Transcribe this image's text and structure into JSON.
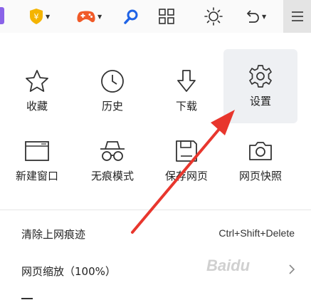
{
  "toolbar": {
    "icons": [
      "extension-stub-icon",
      "yen-shield-icon",
      "gamepad-icon",
      "search-icon",
      "grid-icon",
      "brightness-icon",
      "undo-icon",
      "hamburger-menu-icon"
    ]
  },
  "grid": {
    "row1": [
      {
        "label": "收藏",
        "icon": "star-icon"
      },
      {
        "label": "历史",
        "icon": "clock-icon"
      },
      {
        "label": "下载",
        "icon": "download-arrow-icon"
      },
      {
        "label": "设置",
        "icon": "gear-icon"
      }
    ],
    "row2": [
      {
        "label": "新建窗口",
        "icon": "new-window-icon"
      },
      {
        "label": "无痕模式",
        "icon": "incognito-icon"
      },
      {
        "label": "保存网页",
        "icon": "save-page-icon"
      },
      {
        "label": "网页快照",
        "icon": "camera-icon"
      }
    ]
  },
  "menu": {
    "clear": {
      "label": "清除上网痕迹",
      "shortcut": "Ctrl+Shift+Delete"
    },
    "zoom": {
      "label": "网页缩放（100%）"
    }
  },
  "watermark": {
    "text": "Baidu"
  },
  "colors": {
    "accent_active_bg": "#eef0f3",
    "annotation_arrow": "#e8362d",
    "shield": "#f4b400",
    "gamepad": "#f05a28",
    "search": "#1f63e6"
  }
}
